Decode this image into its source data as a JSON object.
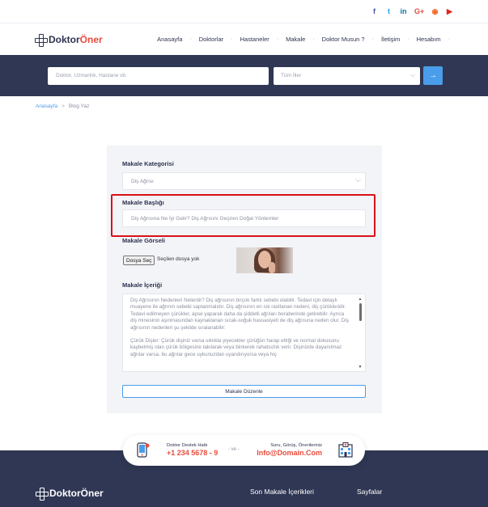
{
  "topbar": {
    "social": [
      {
        "icon": "facebook-icon",
        "glyph": "f",
        "color": "#3b5998"
      },
      {
        "icon": "twitter-icon",
        "glyph": "t",
        "color": "#1da1f2"
      },
      {
        "icon": "linkedin-icon",
        "glyph": "in",
        "color": "#0e76a8"
      },
      {
        "icon": "google-plus-icon",
        "glyph": "G+",
        "color": "#dd4b39"
      },
      {
        "icon": "rss-icon",
        "glyph": "◉",
        "color": "#f26522"
      },
      {
        "icon": "youtube-icon",
        "glyph": "▶",
        "color": "#e62117"
      }
    ]
  },
  "header": {
    "logo_main": "Doktor",
    "logo_accent": "Öner",
    "nav": [
      "Anasayfa",
      "Doktorlar",
      "Hastaneler",
      "Makale",
      "Doktor Musun ?",
      "İletişim",
      "Hesabım"
    ]
  },
  "search": {
    "placeholder": "Doktor, Uzmanlık, Hastane vb.",
    "city_value": "Tüm İller",
    "button_glyph": "→"
  },
  "breadcrumb": {
    "home": "Anasayfa",
    "separator": ">",
    "current": "Blog Yaz"
  },
  "form": {
    "category_label": "Makale Kategorisi",
    "category_value": "Diş Ağrısı",
    "title_label": "Makale Başlığı",
    "title_value": "Diş Ağrısına Ne İyi Gelir? Diş Ağrısını Geçiren Doğal Yöntemler",
    "image_label": "Makale Görseli",
    "file_button": "Dosya Seç",
    "file_status": "Seçilen dosya yok",
    "content_label": "Makale İçeriği",
    "content_paragraphs": [
      "Diş Ağrısının Nedenleri Nelerdir? Diş ağrısının birçok farklı sebebi olabilir. Tedavi için detaylı muayene ile ağrının sebebi saptanmalıdır. Diş ağrısının en sık rastlanan nedeni, diş çürükleridir. Tedavi edilmeyen çürükler, apse yaparak daha da şiddetli ağrıları beraberinde getirebilir. Ayrıca diş minesinin aşınmasından kaynaklanan sıcak-soğuk hassasiyeti de diş ağrısına neden olur. Diş ağrısının nedenleri şu şekilde sıralanabilir:",
      "Çürük Dişler: Çürük dişiniz varsa sıklıkla yiyecekler çürüğün harap ettiği ve normal dokusunu kaybetmiş olan çürük bölgesine takılarak veya binkerek rahatsızlık verir. Dişinizde dayanılmaz ağrılar varsa, bu ağrılar gece uykunuzdan uyandırıyorsa veya hiç"
    ],
    "submit_label": "Makale Düzenle"
  },
  "support": {
    "left_small": "Doktor Destek Hattı",
    "left_big": "+1 234 5678 - 9",
    "middle": "- ve -",
    "right_small": "Soru, Görüş, Önerileriniz",
    "right_big": "Info@Domain.Com"
  },
  "footer": {
    "logo_main": "Doktor",
    "logo_accent": "Öner",
    "col1_title": "Son Makale İçerikleri",
    "col2_title": "Sayfalar"
  }
}
